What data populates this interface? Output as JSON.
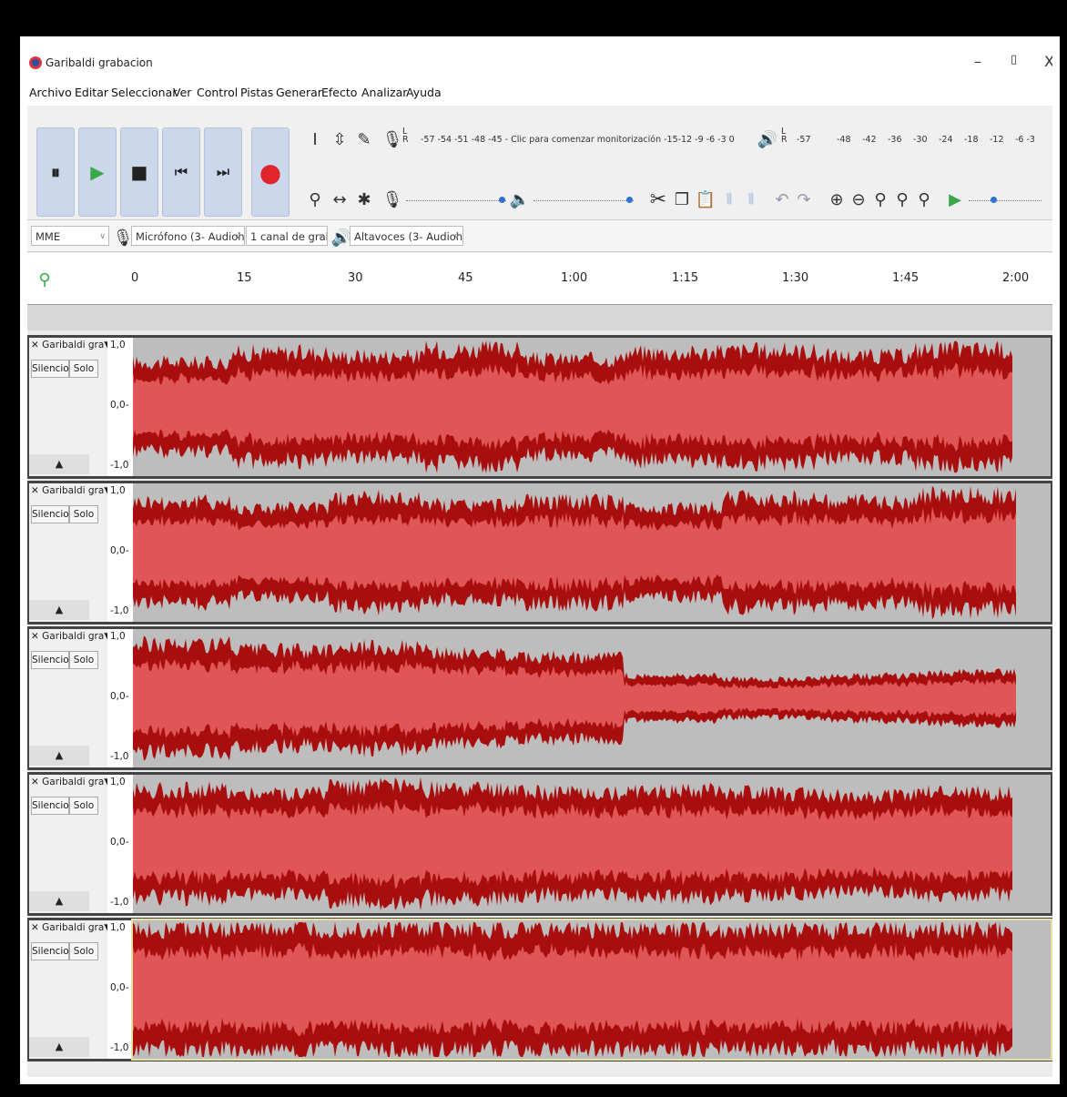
{
  "window": {
    "title": "Garibaldi grabacion",
    "min_glyph": "–",
    "max_glyph": "▯",
    "close_glyph": "X"
  },
  "menu": [
    "Archivo",
    "Editar",
    "Seleccionar",
    "Ver",
    "Control",
    "Pistas",
    "Generar",
    "Efecto",
    "Analizar",
    "Ayuda"
  ],
  "transport": {
    "pause": "⏸",
    "play": "▶",
    "stop": "■",
    "skip_start": "⏮",
    "skip_end": "⏭",
    "record": "●"
  },
  "meters": {
    "record_scale": "-57 -54 -51 -48 -45 - Clic para comenzar monitorización -15-12 -9 -6 -3 0",
    "playback_scale": [
      "-57",
      "-48",
      "-42",
      "-36",
      "-30",
      "-24",
      "-18",
      "-12",
      "-6 -3"
    ],
    "lr": "L\nR"
  },
  "device": {
    "host": "MME",
    "input": "Micrófono (3- Audiohu",
    "channels": "1 canal de grab",
    "output": "Altavoces (3- Audiohu"
  },
  "ruler": {
    "labels": [
      "0",
      "15",
      "30",
      "45",
      "1:00",
      "1:15",
      "1:30",
      "1:45",
      "2:00"
    ]
  },
  "tracks": [
    {
      "name": "Garibaldi gra▼",
      "mute": "Silencio",
      "solo": "Solo",
      "collapse": "▲",
      "scale": [
        "1,0",
        "0,0-",
        "-1,0"
      ],
      "amp": [
        0.7,
        0.85,
        0.8,
        0.9,
        0.75,
        0.85,
        0.88,
        0.8,
        0.9
      ]
    },
    {
      "name": "Garibaldi gra▼",
      "mute": "Silencio",
      "solo": "Solo",
      "collapse": "▲",
      "scale": [
        "1,0",
        "0,0-",
        "-1,0"
      ],
      "amp": [
        0.8,
        0.7,
        0.85,
        0.75,
        0.8,
        0.7,
        0.85,
        0.8,
        0.9
      ]
    },
    {
      "name": "Garibaldi gra▼",
      "mute": "Silencio",
      "solo": "Solo",
      "collapse": "▲",
      "scale": [
        "1,0",
        "0,0-",
        "-1,0"
      ],
      "amp": [
        0.85,
        0.75,
        0.8,
        0.7,
        0.65,
        0.35,
        0.3,
        0.35,
        0.4
      ]
    },
    {
      "name": "Garibaldi gra▼",
      "mute": "Silencio",
      "solo": "Solo",
      "collapse": "▲",
      "scale": [
        "1,0",
        "0,0-",
        "-1,0"
      ],
      "amp": [
        0.85,
        0.8,
        0.9,
        0.85,
        0.8,
        0.85,
        0.8,
        0.75,
        0.8
      ]
    },
    {
      "name": "Garibaldi gra▼",
      "mute": "Silencio",
      "solo": "Solo",
      "collapse": "▲",
      "scale": [
        "1,0",
        "0,0-",
        "-1,0"
      ],
      "amp": [
        0.95,
        0.95,
        0.95,
        0.95,
        0.95,
        0.95,
        0.95,
        0.95,
        0.95
      ]
    }
  ],
  "colors": {
    "wave_fill": "#e05555",
    "wave_peak": "#a80e0e",
    "wave_bg": "#bdbdbd"
  }
}
